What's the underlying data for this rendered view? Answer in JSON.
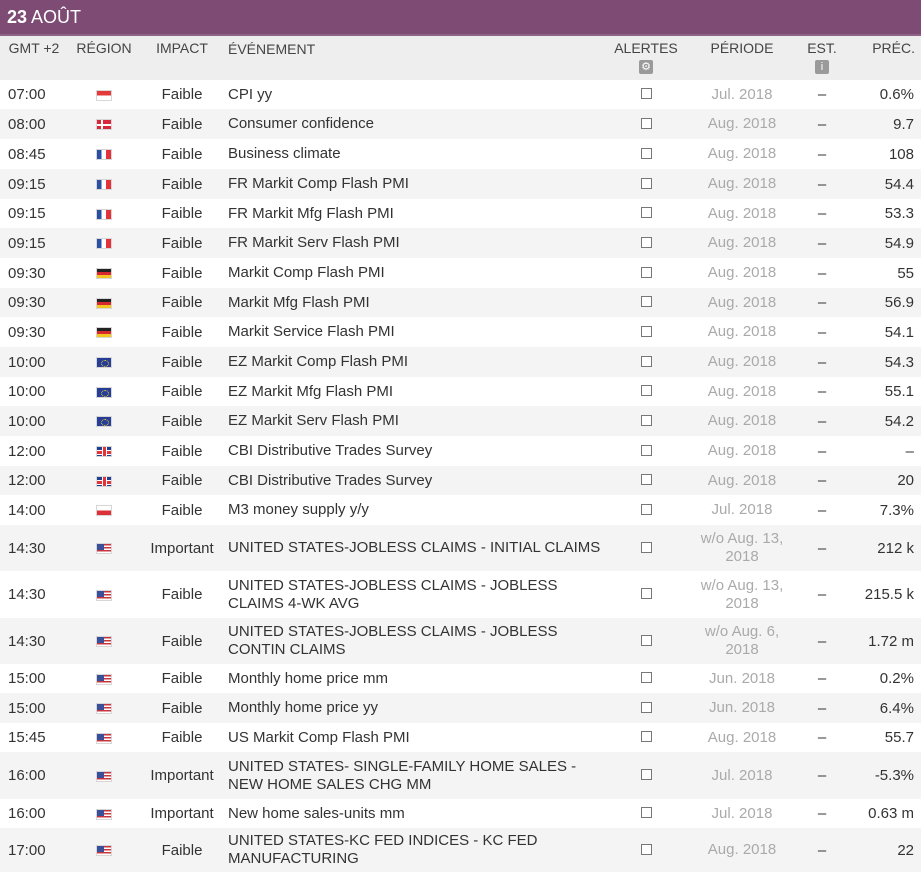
{
  "day": {
    "number": "23",
    "month": "AOÛT"
  },
  "columns": {
    "time": "GMT +2",
    "region": "RÉGION",
    "impact": "IMPACT",
    "event": "ÉVÉNEMENT",
    "alerts": "ALERTES",
    "period": "PÉRIODE",
    "estimate": "EST.",
    "previous": "PRÉC.",
    "alerts_icon": "gear-icon",
    "estimate_icon": "info-icon"
  },
  "colors": {
    "header_bg": "#7d4b74",
    "alt_row": "#f4f4f4",
    "period_text": "#aaaaaa"
  },
  "events": [
    {
      "time": "07:00",
      "flag": "sg",
      "impact": "Faible",
      "event": "CPI yy",
      "period": "Jul. 2018",
      "est": "–",
      "prev": "0.6%"
    },
    {
      "time": "08:00",
      "flag": "dk",
      "impact": "Faible",
      "event": "Consumer confidence",
      "period": "Aug. 2018",
      "est": "–",
      "prev": "9.7"
    },
    {
      "time": "08:45",
      "flag": "fr",
      "impact": "Faible",
      "event": "Business climate",
      "period": "Aug. 2018",
      "est": "–",
      "prev": "108"
    },
    {
      "time": "09:15",
      "flag": "fr",
      "impact": "Faible",
      "event": "FR Markit Comp Flash PMI",
      "period": "Aug. 2018",
      "est": "–",
      "prev": "54.4"
    },
    {
      "time": "09:15",
      "flag": "fr",
      "impact": "Faible",
      "event": "FR Markit Mfg Flash PMI",
      "period": "Aug. 2018",
      "est": "–",
      "prev": "53.3"
    },
    {
      "time": "09:15",
      "flag": "fr",
      "impact": "Faible",
      "event": "FR Markit Serv Flash PMI",
      "period": "Aug. 2018",
      "est": "–",
      "prev": "54.9"
    },
    {
      "time": "09:30",
      "flag": "de",
      "impact": "Faible",
      "event": "Markit Comp Flash PMI",
      "period": "Aug. 2018",
      "est": "–",
      "prev": "55"
    },
    {
      "time": "09:30",
      "flag": "de",
      "impact": "Faible",
      "event": "Markit Mfg Flash PMI",
      "period": "Aug. 2018",
      "est": "–",
      "prev": "56.9"
    },
    {
      "time": "09:30",
      "flag": "de",
      "impact": "Faible",
      "event": "Markit Service Flash PMI",
      "period": "Aug. 2018",
      "est": "–",
      "prev": "54.1"
    },
    {
      "time": "10:00",
      "flag": "eu",
      "impact": "Faible",
      "event": "EZ Markit Comp Flash PMI",
      "period": "Aug. 2018",
      "est": "–",
      "prev": "54.3"
    },
    {
      "time": "10:00",
      "flag": "eu",
      "impact": "Faible",
      "event": "EZ Markit Mfg Flash PMI",
      "period": "Aug. 2018",
      "est": "–",
      "prev": "55.1"
    },
    {
      "time": "10:00",
      "flag": "eu",
      "impact": "Faible",
      "event": "EZ Markit Serv Flash PMI",
      "period": "Aug. 2018",
      "est": "–",
      "prev": "54.2"
    },
    {
      "time": "12:00",
      "flag": "gb",
      "impact": "Faible",
      "event": "CBI Distributive Trades Survey",
      "period": "Aug. 2018",
      "est": "–",
      "prev": "–"
    },
    {
      "time": "12:00",
      "flag": "gb",
      "impact": "Faible",
      "event": "CBI Distributive Trades Survey",
      "period": "Aug. 2018",
      "est": "–",
      "prev": "20"
    },
    {
      "time": "14:00",
      "flag": "pl",
      "impact": "Faible",
      "event": "M3 money supply y/y",
      "period": "Jul. 2018",
      "est": "–",
      "prev": "7.3%"
    },
    {
      "time": "14:30",
      "flag": "us",
      "impact": "Important",
      "event": "UNITED STATES-JOBLESS CLAIMS - INITIAL CLAIMS",
      "period": "w/o Aug. 13, 2018",
      "est": "–",
      "prev": "212 k"
    },
    {
      "time": "14:30",
      "flag": "us",
      "impact": "Faible",
      "event": "UNITED STATES-JOBLESS CLAIMS - JOBLESS CLAIMS 4-WK AVG",
      "period": "w/o Aug. 13, 2018",
      "est": "–",
      "prev": "215.5 k"
    },
    {
      "time": "14:30",
      "flag": "us",
      "impact": "Faible",
      "event": "UNITED STATES-JOBLESS CLAIMS - JOBLESS CONTIN CLAIMS",
      "period": "w/o Aug. 6, 2018",
      "est": "–",
      "prev": "1.72 m"
    },
    {
      "time": "15:00",
      "flag": "us",
      "impact": "Faible",
      "event": "Monthly home price mm",
      "period": "Jun. 2018",
      "est": "–",
      "prev": "0.2%"
    },
    {
      "time": "15:00",
      "flag": "us",
      "impact": "Faible",
      "event": "Monthly home price yy",
      "period": "Jun. 2018",
      "est": "–",
      "prev": "6.4%"
    },
    {
      "time": "15:45",
      "flag": "us",
      "impact": "Faible",
      "event": "US Markit Comp Flash PMI",
      "period": "Aug. 2018",
      "est": "–",
      "prev": "55.7"
    },
    {
      "time": "16:00",
      "flag": "us",
      "impact": "Important",
      "event": "UNITED STATES- SINGLE-FAMILY HOME SALES - NEW HOME SALES CHG MM",
      "period": "Jul. 2018",
      "est": "–",
      "prev": "-5.3%"
    },
    {
      "time": "16:00",
      "flag": "us",
      "impact": "Important",
      "event": "New home sales-units mm",
      "period": "Jul. 2018",
      "est": "–",
      "prev": "0.63 m"
    },
    {
      "time": "17:00",
      "flag": "us",
      "impact": "Faible",
      "event": "UNITED STATES-KC FED INDICES - KC FED MANUFACTURING",
      "period": "Aug. 2018",
      "est": "–",
      "prev": "22"
    }
  ]
}
